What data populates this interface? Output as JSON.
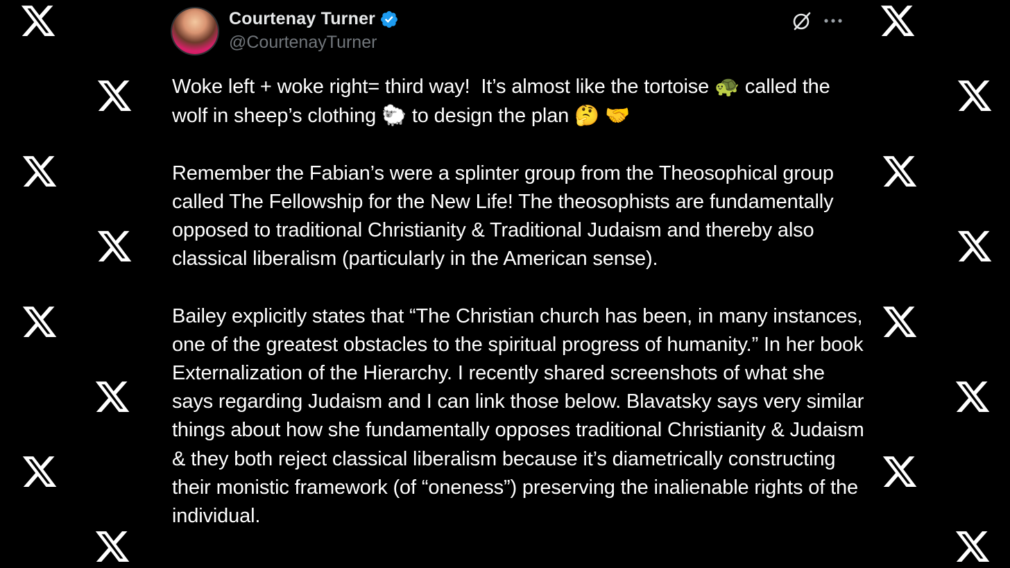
{
  "author": {
    "display_name": "Courtenay Turner",
    "handle": "@CourtenayTurner",
    "verified": true,
    "verified_color": "#1d9bf0"
  },
  "icons": {
    "grok": "grok-slash-circle-icon",
    "more": "more-horizontal-icon",
    "background": "x-logo-icon"
  },
  "tweet": {
    "paragraph_1": {
      "a": "Woke left + woke right= third way!  It’s almost like the tortoise ",
      "emoji_1": "🐢",
      "b": " called the wolf in sheep’s clothing ",
      "emoji_2": "🐑",
      "c": " to design the plan ",
      "emoji_3": "🤔",
      "d": " ",
      "emoji_4": "🤝"
    },
    "paragraph_2": "Remember the Fabian’s were a splinter group from the Theosophical group called The Fellowship for the New Life! The theosophists are fundamentally opposed to traditional Christianity & Traditional Judaism and thereby also classical liberalism (particularly in the American sense).",
    "paragraph_3": "Bailey explicitly states that “The Christian church has been, in many instances, one of the greatest obstacles to the spiritual progress of humanity.” In her book Externalization of the Hierarchy. I recently shared screenshots of what she says regarding Judaism and I can link those below. Blavatsky says very similar things about how she fundamentally opposes traditional Christianity & Judaism & they both reject classical liberalism because it’s diametrically constructing their monistic framework (of “oneness”) preserving the inalienable rights of the individual."
  },
  "colors": {
    "background": "#000000",
    "text": "#ffffff",
    "handle": "#71767b"
  }
}
